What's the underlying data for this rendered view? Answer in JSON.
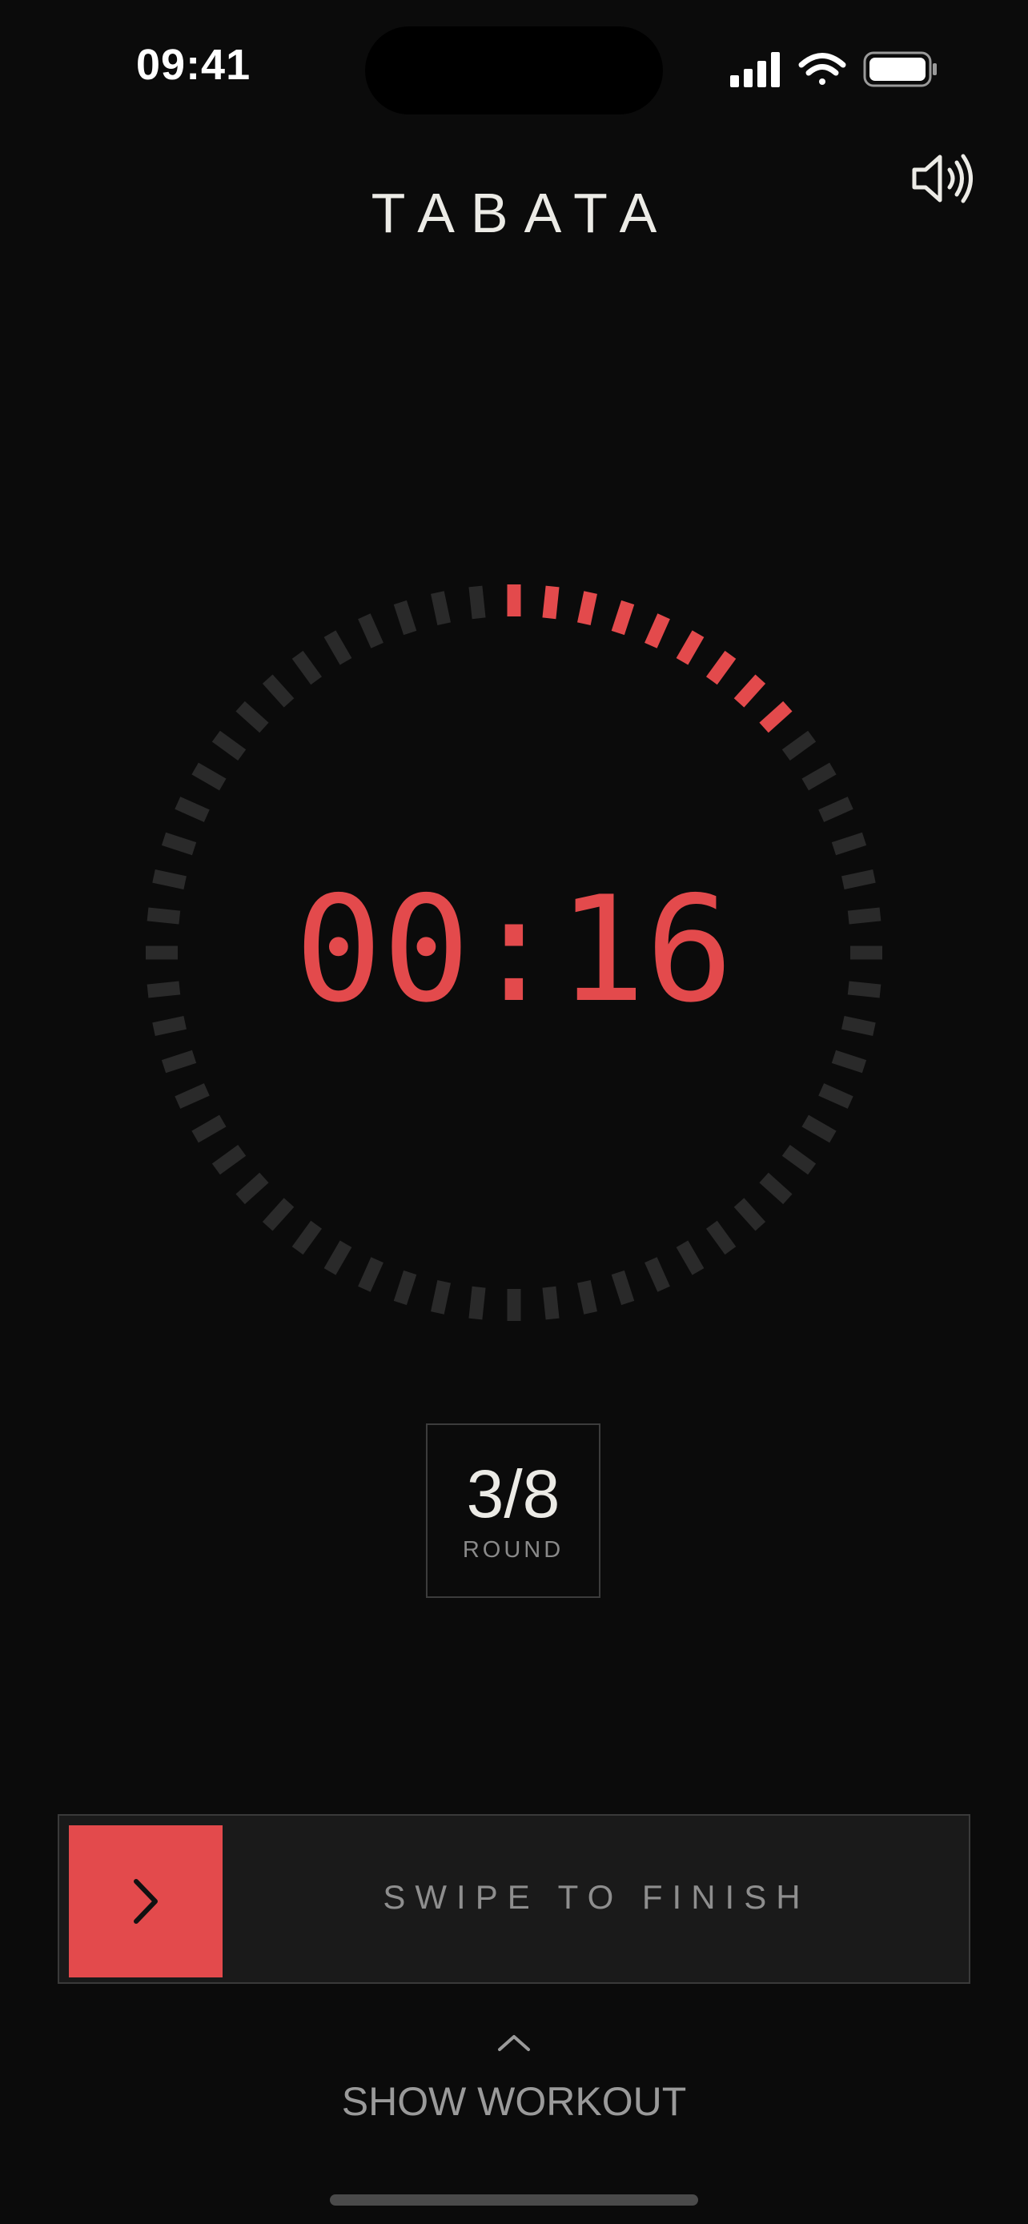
{
  "status_bar": {
    "time": "09:41",
    "icons": [
      "signal-icon",
      "wifi-icon",
      "battery-icon"
    ]
  },
  "header": {
    "title": "TABATA",
    "sound_icon": "speaker-icon"
  },
  "timer": {
    "display": "00:16",
    "progress_ticks_filled": 9,
    "progress_ticks_total": 60,
    "accent_color": "#e34a4c",
    "inactive_tick_color": "#2a2a2a"
  },
  "round": {
    "value": "3/8",
    "label": "ROUND"
  },
  "swipe": {
    "label": "SWIPE TO FINISH",
    "handle_icon": "chevron-right-icon",
    "handle_color": "#e34a4c"
  },
  "footer": {
    "toggle_label": "SHOW WORKOUT",
    "toggle_icon": "chevron-up-icon"
  }
}
